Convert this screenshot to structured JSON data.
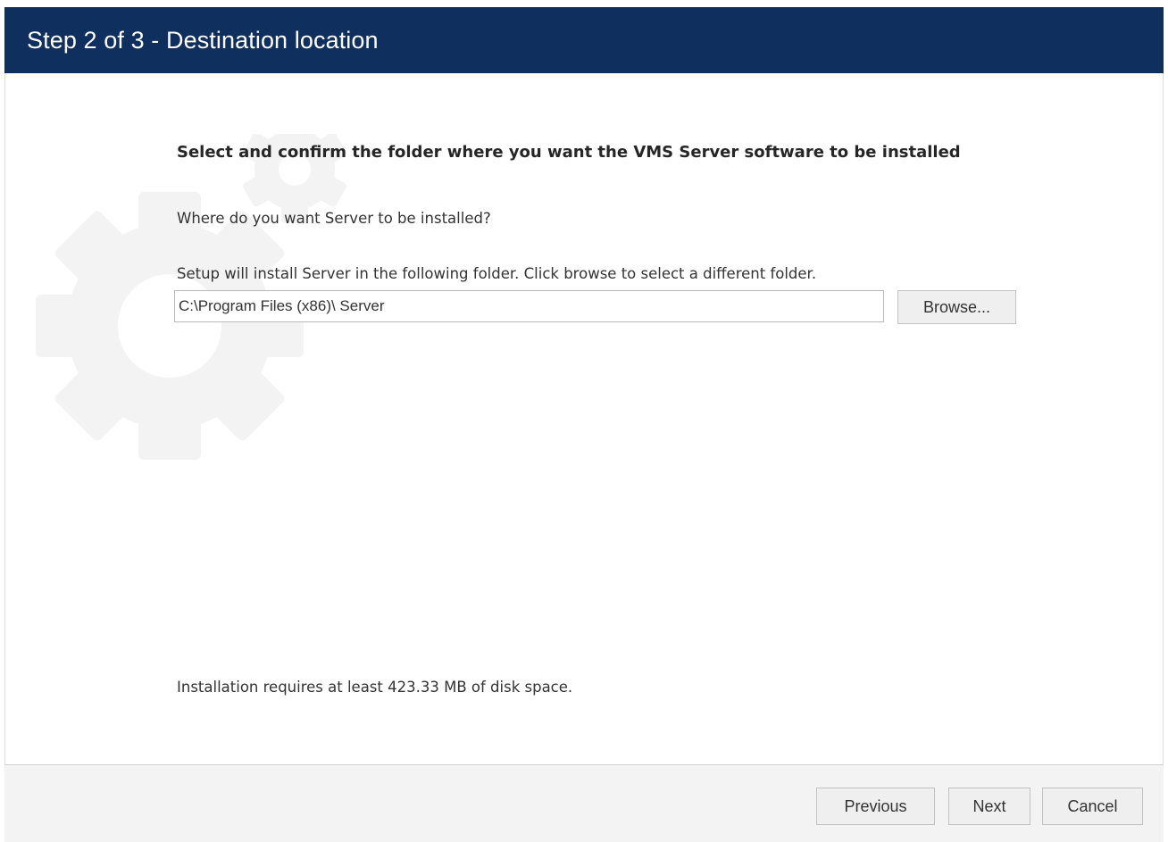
{
  "window": {
    "title": "Step 2 of 3 - Destination location"
  },
  "main": {
    "heading": "Select and confirm the folder where you want the VMS Server software to be installed",
    "question": "Where do you want Server to be installed?",
    "instruction": "Setup will install Server in the following folder. Click browse to select a different folder.",
    "install_path": "C:\\Program Files (x86)\\ Server",
    "browse_label": "Browse...",
    "disk_space_note": "Installation requires at least 423.33 MB of disk space."
  },
  "footer": {
    "previous_label": "Previous",
    "next_label": "Next",
    "cancel_label": "Cancel"
  },
  "icons": {
    "watermark": "gear-icon"
  },
  "colors": {
    "title_bar": "#0f2f5e",
    "title_text": "#ffffff",
    "watermark_gear": "#f3f3f3",
    "footer_bg": "#f3f3f3"
  }
}
